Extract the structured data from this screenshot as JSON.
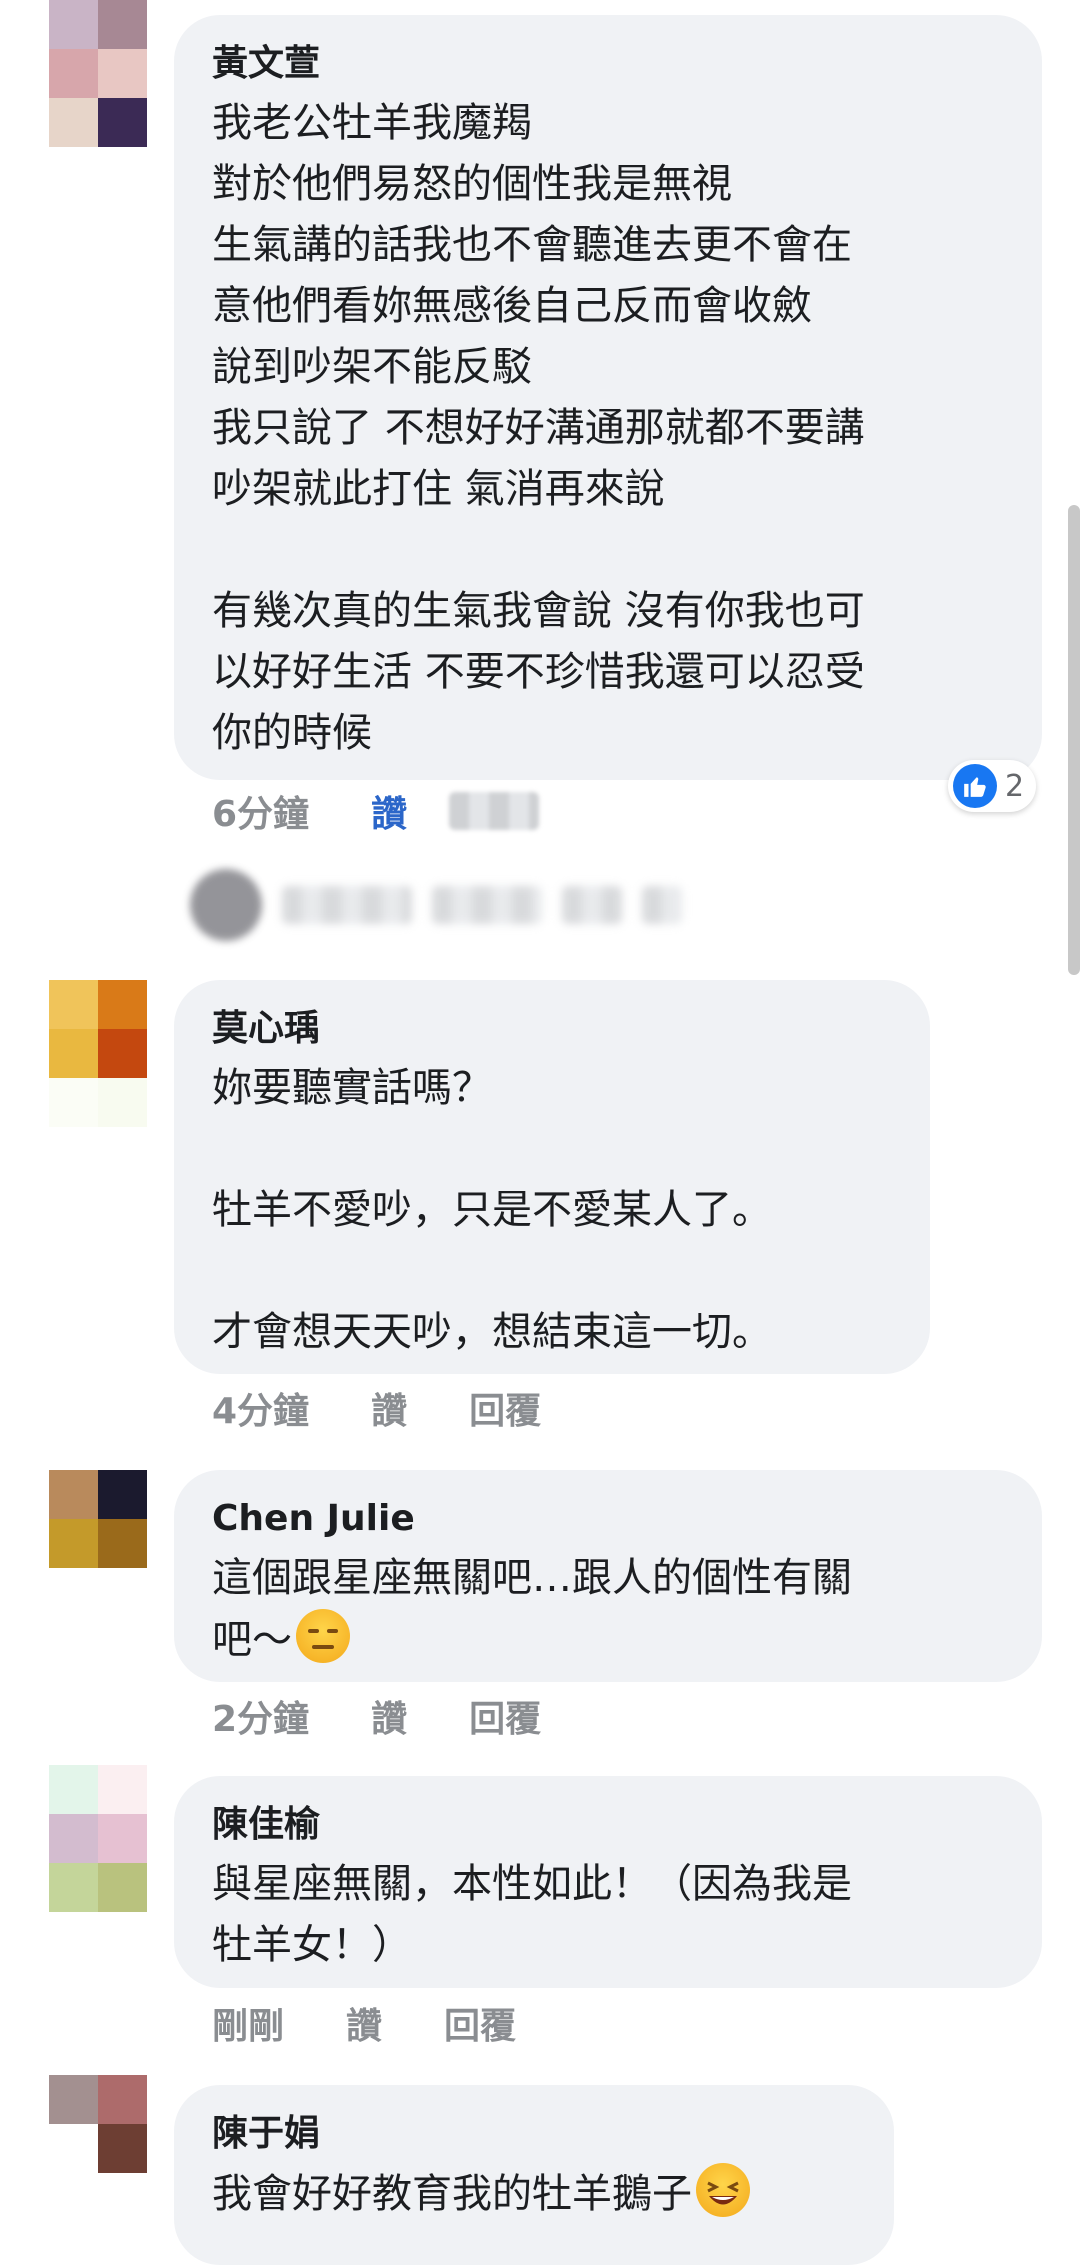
{
  "comments": [
    {
      "author": "黃文萱",
      "body": "我老公牡羊我魔羯\n對於他們易怒的個性我是無視\n生氣講的話我也不會聽進去更不會在\n意他們看妳無感後自己反而會收斂\n說到吵架不能反駁\n我只說了 不想好好溝通那就都不要講\n吵架就此打住 氣消再來說\n\n有幾次真的生氣我會說 沒有你我也可\n以好好生活 不要不珍惜我還可以忍受\n你的時候",
      "time": "6分鐘",
      "like_label": "讚",
      "reply_label": "回覆",
      "reaction_count": "2",
      "avatar_colors": [
        "#c9b4c6",
        "#a78894",
        "#d7a6ab",
        "#e8c7c3",
        "#e7d5c9",
        "#3b2a55"
      ]
    },
    {
      "author": "莫心瑀",
      "body": "妳要聽實話嗎？\n\n牡羊不愛吵，只是不愛某人了。\n\n才會想天天吵，想結束這一切。",
      "time": "4分鐘",
      "like_label": "讚",
      "reply_label": "回覆",
      "avatar_colors": [
        "#f0c45a",
        "#d97a18",
        "#e9b840",
        "#c4480f",
        "#fbfdf6",
        "#f8fbf0"
      ]
    },
    {
      "author": "Chen Julie",
      "body": "這個跟星座無關吧…跟人的個性有關\n吧～",
      "emoji": "expressionless-face",
      "time": "2分鐘",
      "like_label": "讚",
      "reply_label": "回覆",
      "avatar_colors": [
        "#b98a5c",
        "#1b1a2e",
        "#c49a2a",
        "#9a6a1b",
        "#ffffff",
        "#ffffff"
      ]
    },
    {
      "author": "陳佳榆",
      "body": "與星座無關，本性如此！（因為我是\n牡羊女！）",
      "time": "剛剛",
      "like_label": "讚",
      "reply_label": "回覆",
      "avatar_colors": [
        "#e3f5ea",
        "#fbeff1",
        "#d3bccf",
        "#e6c1d2",
        "#c4d59a",
        "#b9c27e"
      ]
    },
    {
      "author": "陳于娟",
      "body": "我會好好教育我的牡羊鵝子",
      "emoji": "grinning-squinting-face",
      "avatar_colors": [
        "#a39090",
        "#ad6b6b",
        "#ffffff",
        "#6d3e33",
        "#ffffff",
        "#ffffff"
      ]
    }
  ]
}
